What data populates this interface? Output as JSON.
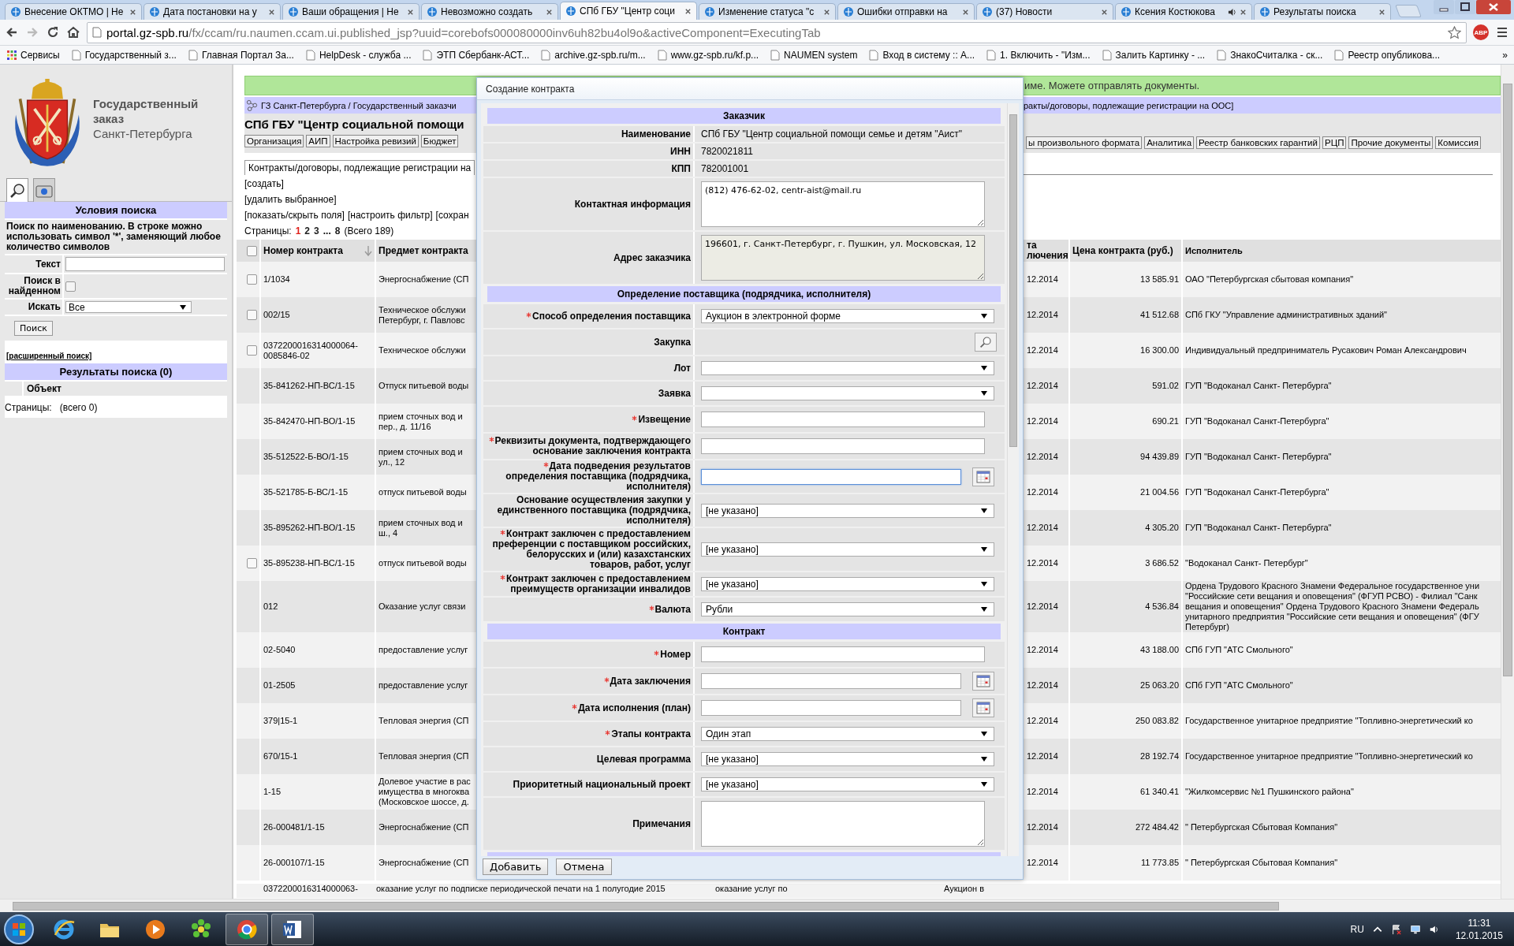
{
  "browser": {
    "tabs": [
      {
        "title": "Внесение ОКТМО | Не",
        "selected": false,
        "audio": false
      },
      {
        "title": "Дата постановки на у",
        "selected": false,
        "audio": false
      },
      {
        "title": "Ваши обращения | Не",
        "selected": false,
        "audio": false
      },
      {
        "title": "Невозможно создать",
        "selected": false,
        "audio": false
      },
      {
        "title": "СПб ГБУ \"Центр соци",
        "selected": true,
        "audio": false
      },
      {
        "title": "Изменение статуса \"с",
        "selected": false,
        "audio": false
      },
      {
        "title": "Ошибки отправки на",
        "selected": false,
        "audio": false
      },
      {
        "title": "(37) Новости",
        "selected": false,
        "audio": false
      },
      {
        "title": "Ксения Костюкова",
        "selected": false,
        "audio": true
      },
      {
        "title": "Результаты поиска",
        "selected": false,
        "audio": false
      }
    ],
    "address": {
      "host": "portal.gz-spb.ru",
      "path": "/fx/ccam/ru.naumen.ccam.ui.published_jsp?uuid=corebofs000080000inv6uh82bu4ol9o&activeComponent=ExecutingTab"
    },
    "extension_badge": "ABP",
    "bookmarks": [
      "Сервисы",
      "Государственный з...",
      "Главная Портал За...",
      "HelpDesk - служба ...",
      "ЭТП Сбербанк-АСТ...",
      "archive.gz-spb.ru/m...",
      "www.gz-spb.ru/kf.p...",
      "NAUMEN system",
      "Вход в систему :: А...",
      "1. Включить - \"Изм...",
      "Залить Картинку - ...",
      "ЗнакоСчиталка - ск...",
      "Реестр опубликова..."
    ],
    "bookmarks_more": "»"
  },
  "sidebar": {
    "logo": {
      "title": "Государственный\nзаказ",
      "subtitle": "Санкт-Петербурга"
    },
    "panel_tabs": [
      {
        "kind": "search",
        "selected": true
      },
      {
        "kind": "catalog",
        "selected": false
      }
    ],
    "search": {
      "title": "Условия поиска",
      "hint": "Поиск по наименованию. В строке можно использовать символ '*', заменяющий любое количество символов",
      "fields": [
        {
          "kind": "text",
          "label": "Текст"
        },
        {
          "kind": "checkbox",
          "label": "Поиск в найденном",
          "checked": false
        },
        {
          "kind": "select",
          "label": "Искать",
          "value": "Все"
        }
      ],
      "button": "Поиск",
      "advanced_link": "[расширенный поиск]"
    },
    "results": {
      "title": "Результаты поиска (0)",
      "column": "Объект",
      "pages_label": "Страницы:",
      "total": "(всего 0)"
    }
  },
  "main": {
    "notice": "име. Можете отправлять документы.",
    "breadcrumb_left": "ГЗ Санкт-Петербурга / Государственный заказчи",
    "breadcrumb_right": "ракты/договоры, подлежащие регистрации на ООС]",
    "org_title": "СПб ГБУ \"Центр социальной помощи",
    "nav_left": [
      "Организация",
      "АИП",
      "Настройка ревизий",
      "Бюджет"
    ],
    "nav_right": [
      "ы произвольного формата",
      "Аналитика",
      "Реестр банковских гарантий",
      "РЦП",
      "Прочие документы",
      "Комиссия"
    ],
    "tab": "Контракты/договоры, подлежащие регистрации на",
    "actions": [
      [
        "[создать]"
      ],
      [
        "[удалить выбранное]"
      ],
      [
        "[показать/скрыть поля]",
        "[настроить фильтр]",
        "[сохран"
      ]
    ],
    "pager": {
      "label": "Страницы:",
      "pages": [
        {
          "label": "1",
          "selected": true
        },
        {
          "label": "2",
          "selected": false
        },
        {
          "label": "3",
          "selected": false
        },
        {
          "label": "8",
          "selected": false
        }
      ],
      "gap": "...",
      "total": "(Всего 189)"
    },
    "table": {
      "select_all_checked": false,
      "columns_left": [
        "Номер контракта",
        "Предмет контракта"
      ],
      "columns_right": [
        "та\nлючения",
        "Цена контракта (руб.)",
        "Исполнитель"
      ],
      "rows": [
        {
          "checked": false,
          "number": "1/1034",
          "subject": "Энергоснабжение (СП",
          "date": "12.2014",
          "price": "13 585.91",
          "executor": "ОАО \"Петербургская сбытовая компания\""
        },
        {
          "checked": false,
          "number": "002/15",
          "subject": "Техническое обслужи\nПетербург, г. Павловс",
          "date": "12.2014",
          "price": "41 512.68",
          "executor": "СПб ГКУ \"Управление административных зданий\""
        },
        {
          "checked": false,
          "number": "0372200016314000064-\n0085846-02",
          "subject": "Техническое обслужи",
          "date": "12.2014",
          "price": "16 300.00",
          "executor": "Индивидуальный предприниматель Русакович Роман Александрович"
        },
        {
          "number": "35-841262-НП-ВС/1-15",
          "subject": "Отпуск питьевой воды",
          "date": "12.2014",
          "price": "591.02",
          "executor": "ГУП \"Водоканал Санкт- Петербурга\""
        },
        {
          "number": "35-842470-НП-ВО/1-15",
          "subject": "прием сточных вод и\nпер., д. 11/16",
          "date": "12.2014",
          "price": "690.21",
          "executor": "ГУП \"Водоканал Санкт-Петербурга\""
        },
        {
          "number": "35-512522-Б-ВО/1-15",
          "subject": "прием сточных вод и\nул., 12",
          "date": "12.2014",
          "price": "94 439.89",
          "executor": "ГУП \"Водоканал Санкт- Петербурга\""
        },
        {
          "number": "35-521785-Б-ВС/1-15",
          "subject": "отпуск питьевой воды",
          "date": "12.2014",
          "price": "21 004.56",
          "executor": "ГУП \"Водоканал Санкт-Петербурга\""
        },
        {
          "number": "35-895262-НП-ВО/1-15",
          "subject": "прием сточных вод и\nш., 4",
          "date": "12.2014",
          "price": "4 305.20",
          "executor": "ГУП \"Водоканал Санкт- Петербурга\""
        },
        {
          "checked": false,
          "number": "35-895238-НП-ВС/1-15",
          "subject": "отпуск питьевой воды",
          "date": "12.2014",
          "price": "3 686.52",
          "executor": "\"Водоканал Санкт- Петербург\""
        },
        {
          "number": "012",
          "subject": "Оказание услуг связи",
          "date": "12.2014",
          "price": "4 536.84",
          "executor": "Ордена Трудового Красного Знамени Федеральное государственное уни\n\"Российские сети вещания и оповещения\" (ФГУП РСВО) - Филиал \"Санк\nвещания и оповещения\" Ордена Трудового Красного Знамени Федераль\nунитарного предприятия \"Российские сети вещания и оповещения\" (ФГУ\nПетербург)"
        },
        {
          "number": "02-5040",
          "subject": "предоставление услуг",
          "date": "12.2014",
          "price": "43 188.00",
          "executor": "СПб ГУП \"АТС Смольного\""
        },
        {
          "number": "01-2505",
          "subject": "предоставление услуг",
          "date": "12.2014",
          "price": "25 063.20",
          "executor": "СПб ГУП \"АТС Смольного\""
        },
        {
          "number": "379|15-1",
          "subject": "Тепловая энергия (СП",
          "date": "12.2014",
          "price": "250 083.82",
          "executor": "Государственное унитарное предприятие \"Топливно-энергетический ко"
        },
        {
          "number": "670/15-1",
          "subject": "Тепловая энергия (СП",
          "date": "12.2014",
          "price": "28 192.74",
          "executor": "Государственное унитарное предприятие \"Топливно-энергетический ко"
        },
        {
          "number": "1-15",
          "subject": "Долевое участие в рас\nимущества в многоква\n(Московское шоссе, д.",
          "date": "12.2014",
          "price": "61 340.41",
          "executor": "\"Жилкомсервис №1 Пушкинского района\""
        },
        {
          "number": "26-000481/1-15",
          "subject": "Энергоснабжение (СП",
          "date": "12.2014",
          "price": "272 484.42",
          "executor": "\" Петербургская Сбытовая Компания\""
        },
        {
          "number": "26-000107/1-15",
          "subject": "Энергоснабжение (СП",
          "date": "12.2014",
          "price": "11 773.85",
          "executor": "\" Петербургская Сбытовая Компания\""
        }
      ],
      "partial_row": [
        "0372200016314000063-",
        "оказание услуг по подписке периодической печати на 1 полугодие 2015",
        "оказание услуг по",
        "Аукцион в"
      ]
    }
  },
  "dialog": {
    "title": "Создание контракта",
    "form": [
      {
        "kind": "section",
        "title": "Заказчик"
      },
      {
        "kind": "text",
        "label": "Наименование",
        "value": "СПб ГБУ \"Центр социальной помощи семье и детям \"Аист\"",
        "required": false
      },
      {
        "kind": "text",
        "label": "ИНН",
        "value": "7820021811",
        "required": false
      },
      {
        "kind": "text",
        "label": "КПП",
        "value": "782001001",
        "required": false
      },
      {
        "kind": "textarea",
        "label": "Контактная информация",
        "value": "(812) 476-62-02, centr-aist@mail.ru",
        "readonly": false,
        "required": false
      },
      {
        "kind": "textarea",
        "label": "Адрес заказчика",
        "value": "196601, г. Санкт-Петербург, г. Пушкин, ул. Московская, 12",
        "readonly": true,
        "required": false
      },
      {
        "kind": "section",
        "title": "Определение поставщика (подрядчика, исполнителя)"
      },
      {
        "kind": "select",
        "label": "Способ определения поставщика",
        "value": "Аукцион в электронной форме",
        "required": true
      },
      {
        "kind": "lookup",
        "label": "Закупка",
        "required": false
      },
      {
        "kind": "select",
        "label": "Лот",
        "required": false
      },
      {
        "kind": "select",
        "label": "Заявка",
        "required": false
      },
      {
        "kind": "input",
        "label": "Извещение",
        "required": true,
        "focused": false
      },
      {
        "kind": "input",
        "label": "Реквизиты документа, подтверждающего основание заключения контракта",
        "required": true,
        "focused": false
      },
      {
        "kind": "date",
        "label": "Дата подведения результатов определения поставщика (подрядчика, исполнителя)",
        "required": true,
        "focused": true
      },
      {
        "kind": "select",
        "label": "Основание осуществления закупки у единственного поставщика (подрядчика, исполнителя)",
        "value": "[не указано]",
        "required": false
      },
      {
        "kind": "select",
        "label": "Контракт заключен с предоставлением преференции с поставщиком российских, белорусских и (или) казахстанских товаров, работ, услуг",
        "value": "[не указано]",
        "required": true
      },
      {
        "kind": "select",
        "label": "Контракт заключен с предоставлением преимуществ организации инвалидов",
        "value": "[не указано]",
        "required": true
      },
      {
        "kind": "select",
        "label": "Валюта",
        "value": "Рубли",
        "required": true
      },
      {
        "kind": "section",
        "title": "Контракт"
      },
      {
        "kind": "input",
        "label": "Номер",
        "required": true,
        "focused": false
      },
      {
        "kind": "date",
        "label": "Дата заключения",
        "required": true,
        "focused": false
      },
      {
        "kind": "date",
        "label": "Дата исполнения (план)",
        "required": true,
        "focused": false
      },
      {
        "kind": "select",
        "label": "Этапы контракта",
        "value": "Один этап",
        "required": true
      },
      {
        "kind": "select",
        "label": "Целевая программа",
        "value": "[не указано]",
        "required": false
      },
      {
        "kind": "select",
        "label": "Приоритетный национальный проект",
        "value": "[не указано]",
        "required": false
      },
      {
        "kind": "textarea",
        "label": "Примечания",
        "readonly": false,
        "required": false
      },
      {
        "kind": "section"
      }
    ],
    "buttons": [
      "Добавить",
      "Отмена"
    ]
  },
  "taskbar": {
    "apps": [
      {
        "kind": "ie",
        "active": false
      },
      {
        "kind": "folder",
        "active": false
      },
      {
        "kind": "media",
        "active": false
      },
      {
        "kind": "icq",
        "active": false
      },
      {
        "kind": "chrome",
        "active": true
      },
      {
        "kind": "word",
        "active": true
      }
    ],
    "language": "RU",
    "time": "11:31",
    "date": "12.01.2015"
  }
}
